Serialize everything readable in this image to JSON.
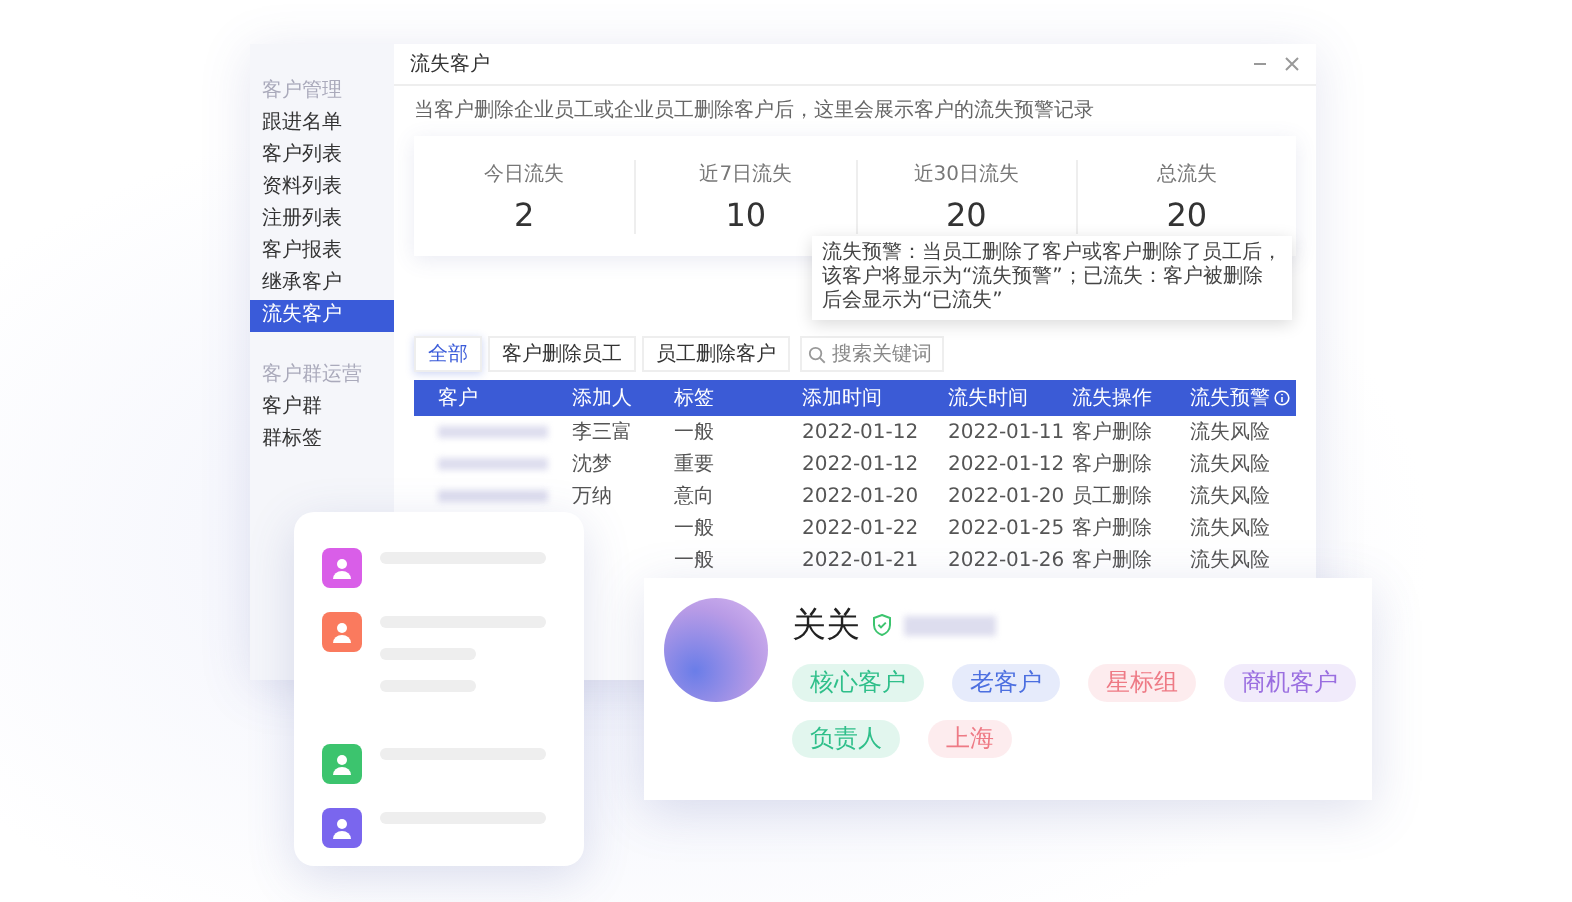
{
  "sidebar": {
    "groups": [
      {
        "label": "客户管理",
        "items": [
          {
            "label": "跟进名单",
            "selected": false
          },
          {
            "label": "客户列表",
            "selected": false
          },
          {
            "label": "资料列表",
            "selected": false
          },
          {
            "label": "注册列表",
            "selected": false
          },
          {
            "label": "客户报表",
            "selected": false
          },
          {
            "label": "继承客户",
            "selected": false
          },
          {
            "label": "流失客户",
            "selected": true
          }
        ]
      },
      {
        "label": "客户群运营",
        "items": [
          {
            "label": "客户群",
            "selected": false
          },
          {
            "label": "群标签",
            "selected": false
          }
        ]
      }
    ]
  },
  "window": {
    "title": "流失客户",
    "description": "当客户删除企业员工或企业员工删除客户后，这里会展示客户的流失预警记录"
  },
  "stats": [
    {
      "label": "今日流失",
      "value": "2"
    },
    {
      "label": "近7日流失",
      "value": "10"
    },
    {
      "label": "近30日流失",
      "value": "20"
    },
    {
      "label": "总流失",
      "value": "20"
    }
  ],
  "filter_tabs": [
    {
      "label": "全部",
      "selected": true
    },
    {
      "label": "客户删除员工",
      "selected": false
    },
    {
      "label": "员工删除客户",
      "selected": false
    }
  ],
  "search": {
    "placeholder": "搜索关键词"
  },
  "tooltip": "流失预警：当员工删除了客户或客户删除了员工后，该客户将显示为“流失预警”；已流失：客户被删除后会显示为“已流失”",
  "table": {
    "columns": [
      "客户",
      "添加人",
      "标签",
      "添加时间",
      "流失时间",
      "流失操作",
      "流失预警"
    ],
    "rows": [
      {
        "kind": "full",
        "adder": "李三富",
        "tag": "一般",
        "added": "2022-01-12",
        "lost": "2022-01-11",
        "operation": "客户删除",
        "warning": "流失风险"
      },
      {
        "kind": "full",
        "adder": "沈梦",
        "tag": "重要",
        "added": "2022-01-12",
        "lost": "2022-01-12",
        "operation": "客户删除",
        "warning": "流失风险"
      },
      {
        "kind": "full",
        "adder": "万纳",
        "tag": "意向",
        "added": "2022-01-20",
        "lost": "2022-01-20",
        "operation": "员工删除",
        "warning": "流失风险"
      },
      {
        "kind": "covered",
        "tag": "一般",
        "added": "2022-01-22",
        "lost": "2022-01-25",
        "operation": "客户删除",
        "warning": "流失风险"
      },
      {
        "kind": "covered",
        "tag": "一般",
        "added": "2022-01-21",
        "lost": "2022-01-26",
        "operation": "客户删除",
        "warning": "流失风险"
      }
    ]
  },
  "profile": {
    "name": "关关",
    "verified": true,
    "tags": [
      {
        "label": "核心客户",
        "color": "#2fbf8a"
      },
      {
        "label": "老客户",
        "color": "#4c6fe0"
      },
      {
        "label": "星标组",
        "color": "#ee7a85"
      },
      {
        "label": "商机客户",
        "color": "#9a6ee0"
      },
      {
        "label": "负责人",
        "color": "#2fbf8a"
      },
      {
        "label": "上海",
        "color": "#ee7a85"
      }
    ]
  },
  "contact_list": [
    {
      "color": "#d95ee8",
      "kind": "single"
    },
    {
      "color": "#fa7a5e",
      "kind": "multi"
    },
    {
      "color": "#3cc46e",
      "kind": "single"
    },
    {
      "color": "#7a66ee",
      "kind": "single"
    }
  ]
}
